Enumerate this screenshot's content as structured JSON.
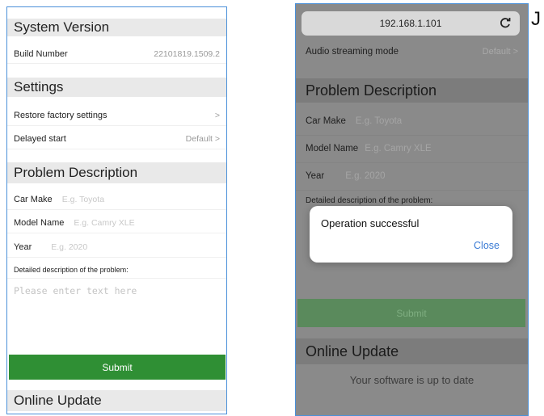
{
  "left": {
    "system_version": {
      "header": "System Version",
      "build_label": "Build Number",
      "build_value": "22101819.1509.2"
    },
    "settings": {
      "header": "Settings",
      "restore_label": "Restore factory settings",
      "restore_chevron": ">",
      "delayed_label": "Delayed start",
      "delayed_value": "Default >"
    },
    "problem": {
      "header": "Problem Description",
      "car_make_label": "Car Make",
      "car_make_placeholder": "E.g. Toyota",
      "model_label": "Model Name",
      "model_placeholder": "E.g. Camry XLE",
      "year_label": "Year",
      "year_placeholder": "E.g. 2020",
      "detail_label": "Detailed description of the problem:",
      "detail_placeholder": "Please enter text here"
    },
    "submit_label": "Submit",
    "online_update_header": "Online Update"
  },
  "right": {
    "url": "192.168.1.101",
    "audio_label": "Audio streaming mode",
    "audio_value": "Default >",
    "problem": {
      "header": "Problem Description",
      "car_make_label": "Car Make",
      "car_make_placeholder": "E.g. Toyota",
      "model_label": "Model Name",
      "model_placeholder": "E.g. Camry XLE",
      "year_label": "Year",
      "year_placeholder": "E.g. 2020",
      "detail_label": "Detailed description of the problem:"
    },
    "dialog": {
      "message": "Operation successful",
      "close_label": "Close"
    },
    "submit_label": "Submit",
    "online_update_header": "Online Update",
    "update_status": "Your software is up to date"
  },
  "corner_letter": "J",
  "colors": {
    "submit_green": "#2f8f34",
    "border_blue": "#4a90d9",
    "link_blue": "#3a7bd5"
  },
  "icons": {
    "reload": "reload-icon"
  }
}
